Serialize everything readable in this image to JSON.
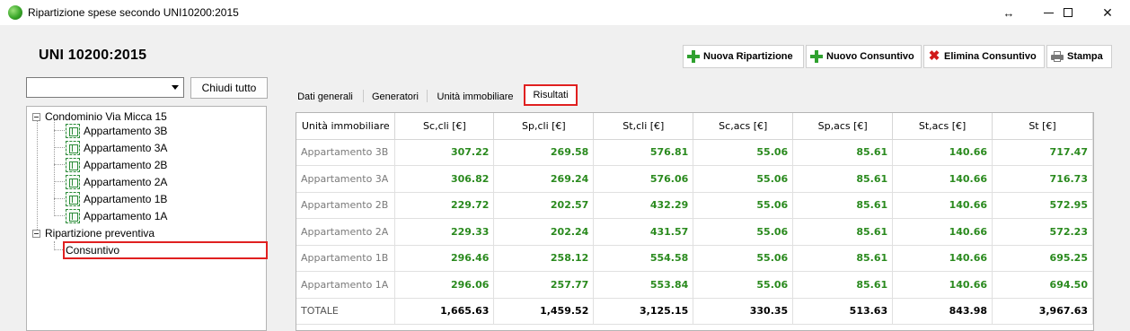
{
  "window": {
    "title": "Ripartizione spese secondo UNI10200:2015",
    "resize_glyph": "↔",
    "close_glyph": "✕"
  },
  "heading": "UNI 10200:2015",
  "toolbar": {
    "nuova_ripartizione": "Nuova Ripartizione",
    "nuovo_consuntivo": "Nuovo Consuntivo",
    "elimina_consuntivo": "Elimina Consuntivo",
    "stampa": "Stampa"
  },
  "left": {
    "combo_value": "",
    "chiudi_label": "Chiudi tutto"
  },
  "tree": {
    "root": "Condominio Via Micca 15",
    "apartments": [
      "Appartamento 3B",
      "Appartamento 3A",
      "Appartamento 2B",
      "Appartamento 2A",
      "Appartamento 1B",
      "Appartamento 1A"
    ],
    "ripartizione": "Ripartizione preventiva",
    "consuntivo": "Consuntivo"
  },
  "tabs": [
    "Dati generali",
    "Generatori",
    "Unità immobiliare",
    "Risultati"
  ],
  "active_tab": "Risultati",
  "table": {
    "headers": [
      "Unità immobiliare",
      "Sc,cli [€]",
      "Sp,cli [€]",
      "St,cli [€]",
      "Sc,acs [€]",
      "Sp,acs [€]",
      "St,acs [€]",
      "St [€]"
    ],
    "rows": [
      [
        "Appartamento 3B",
        "307.22",
        "269.58",
        "576.81",
        "55.06",
        "85.61",
        "140.66",
        "717.47"
      ],
      [
        "Appartamento 3A",
        "306.82",
        "269.24",
        "576.06",
        "55.06",
        "85.61",
        "140.66",
        "716.73"
      ],
      [
        "Appartamento 2B",
        "229.72",
        "202.57",
        "432.29",
        "55.06",
        "85.61",
        "140.66",
        "572.95"
      ],
      [
        "Appartamento 2A",
        "229.33",
        "202.24",
        "431.57",
        "55.06",
        "85.61",
        "140.66",
        "572.23"
      ],
      [
        "Appartamento 1B",
        "296.46",
        "258.12",
        "554.58",
        "55.06",
        "85.61",
        "140.66",
        "695.25"
      ],
      [
        "Appartamento 1A",
        "296.06",
        "257.77",
        "553.84",
        "55.06",
        "85.61",
        "140.66",
        "694.50"
      ]
    ],
    "total": [
      "TOTALE",
      "1,665.63",
      "1,459.52",
      "3,125.15",
      "330.35",
      "513.63",
      "843.98",
      "3,967.63"
    ]
  },
  "colors": {
    "value_green": "#2a8a1e",
    "highlight_red": "#e02020"
  }
}
